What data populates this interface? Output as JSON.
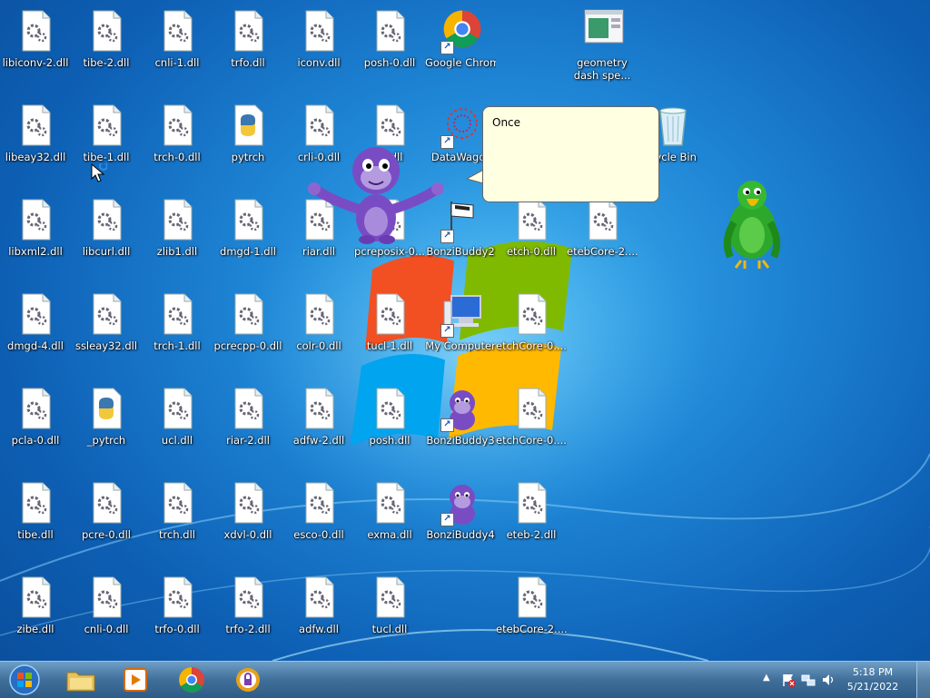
{
  "desktop": {
    "icons": [
      {
        "label": "libiconv-2.dll",
        "type": "dll"
      },
      {
        "label": "tibe-2.dll",
        "type": "dll"
      },
      {
        "label": "cnli-1.dll",
        "type": "dll"
      },
      {
        "label": "trfo.dll",
        "type": "dll"
      },
      {
        "label": "iconv.dll",
        "type": "dll"
      },
      {
        "label": "posh-0.dll",
        "type": "dll"
      },
      {
        "label": "Google Chrome",
        "type": "chrome"
      },
      {
        "label": "geometry dash spe...",
        "type": "window"
      },
      {
        "label": "libeay32.dll",
        "type": "dll"
      },
      {
        "label": "tibe-1.dll",
        "type": "dll"
      },
      {
        "label": "trch-0.dll",
        "type": "dll"
      },
      {
        "label": "pytrch",
        "type": "python"
      },
      {
        "label": "crli-0.dll",
        "type": "dll"
      },
      {
        "label": "-1.dll",
        "type": "dll"
      },
      {
        "label": "DataWagor",
        "type": "datawagon"
      },
      {
        "label": "cycle Bin",
        "type": "recycle"
      },
      {
        "label": "libxml2.dll",
        "type": "dll"
      },
      {
        "label": "libcurl.dll",
        "type": "dll"
      },
      {
        "label": "zlib1.dll",
        "type": "dll"
      },
      {
        "label": "dmgd-1.dll",
        "type": "dll"
      },
      {
        "label": "riar.dll",
        "type": "dll"
      },
      {
        "label": "pcreposix-0...",
        "type": "dll"
      },
      {
        "label": "BonziBuddy2",
        "type": "flag"
      },
      {
        "label": "etch-0.dll",
        "type": "dll"
      },
      {
        "label": "etebCore-2....",
        "type": "dll"
      },
      {
        "label": "dmgd-4.dll",
        "type": "dll"
      },
      {
        "label": "ssleay32.dll",
        "type": "dll"
      },
      {
        "label": "trch-1.dll",
        "type": "dll"
      },
      {
        "label": "pcrecpp-0.dll",
        "type": "dll"
      },
      {
        "label": "colr-0.dll",
        "type": "dll"
      },
      {
        "label": "tucl-1.dll",
        "type": "dll"
      },
      {
        "label": "My Computer",
        "type": "computer"
      },
      {
        "label": "etchCore-0....",
        "type": "dll"
      },
      {
        "label": "pcla-0.dll",
        "type": "dll"
      },
      {
        "label": "_pytrch",
        "type": "python"
      },
      {
        "label": "ucl.dll",
        "type": "dll"
      },
      {
        "label": "riar-2.dll",
        "type": "dll"
      },
      {
        "label": "adfw-2.dll",
        "type": "dll"
      },
      {
        "label": "posh.dll",
        "type": "dll"
      },
      {
        "label": "BonziBuddy3",
        "type": "bonzi"
      },
      {
        "label": "etchCore-0....",
        "type": "dll"
      },
      {
        "label": "tibe.dll",
        "type": "dll"
      },
      {
        "label": "pcre-0.dll",
        "type": "dll"
      },
      {
        "label": "trch.dll",
        "type": "dll"
      },
      {
        "label": "xdvl-0.dll",
        "type": "dll"
      },
      {
        "label": "esco-0.dll",
        "type": "dll"
      },
      {
        "label": "exma.dll",
        "type": "dll"
      },
      {
        "label": "BonziBuddy4",
        "type": "bonzi"
      },
      {
        "label": "eteb-2.dll",
        "type": "dll"
      },
      {
        "label": "zibe.dll",
        "type": "dll"
      },
      {
        "label": "cnli-0.dll",
        "type": "dll"
      },
      {
        "label": "trfo-0.dll",
        "type": "dll"
      },
      {
        "label": "trfo-2.dll",
        "type": "dll"
      },
      {
        "label": "adfw.dll",
        "type": "dll"
      },
      {
        "label": "tucl.dll",
        "type": "dll"
      },
      {
        "label": "etebCore-2....",
        "type": "dll"
      }
    ]
  },
  "bonzi": {
    "speech": "Once"
  },
  "taskbar": {
    "items": [
      "start-button",
      "file-explorer",
      "media-player",
      "google-chrome",
      "hotspot-shield"
    ],
    "clock_time": "5:18 PM",
    "clock_date": "5/21/2022"
  },
  "colors": {
    "desktop_blue": "#1f86d6",
    "taskbar": "#3f6f9a",
    "bubble_bg": "#ffffe1",
    "bonzi_purple": "#7b4cc2",
    "parrot_green": "#2ea82b"
  }
}
